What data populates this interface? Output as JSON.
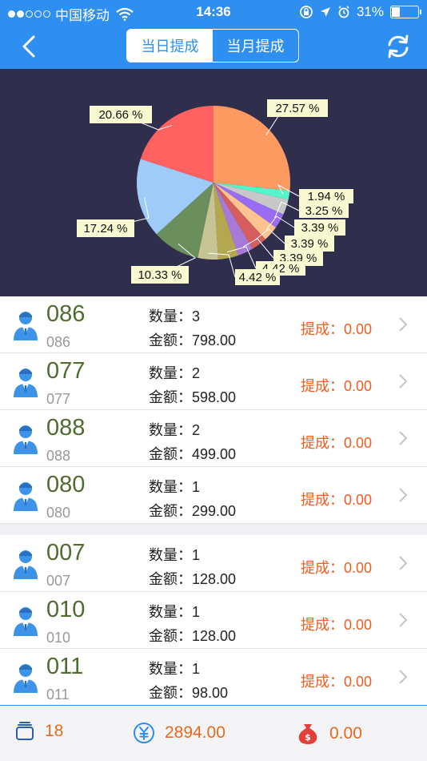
{
  "status": {
    "carrier": "中国移动",
    "time": "14:36",
    "battery": "31%",
    "battery_level": 0.31
  },
  "nav": {
    "back_icon": "chevron-left-icon",
    "tabs": [
      "当日提成",
      "当月提成"
    ],
    "active_tab": 0,
    "refresh_icon": "refresh-icon"
  },
  "chart_data": {
    "type": "pie",
    "slices": [
      {
        "label": "27.57 %",
        "value": 27.57,
        "color": "#fd9a62"
      },
      {
        "label": "1.94 %",
        "value": 1.94,
        "color": "#56f5c9"
      },
      {
        "label": "",
        "value": 3.3,
        "color": "#c8c8c8"
      },
      {
        "label": "3.25 %",
        "value": 3.25,
        "color": "#9a6cf5"
      },
      {
        "label": "3.39 %",
        "value": 3.39,
        "color": "#fdc490"
      },
      {
        "label": "3.39 %",
        "value": 3.39,
        "color": "#d65d5d"
      },
      {
        "label": "3.39 %",
        "value": 3.39,
        "color": "#a77ad8"
      },
      {
        "label": "4.42 %",
        "value": 4.42,
        "color": "#b3a84f"
      },
      {
        "label": "4.42 %",
        "value": 4.42,
        "color": "#c7c494"
      },
      {
        "label": "10.33 %",
        "value": 10.33,
        "color": "#6a8f5c"
      },
      {
        "label": "17.24 %",
        "value": 17.24,
        "color": "#9ecbf8"
      },
      {
        "label": "20.66 %",
        "value": 20.66,
        "color": "#ff6161"
      }
    ],
    "label_display": [
      "27.57 %",
      "1.94 %",
      "3.25 %",
      "3.39 %",
      "3.39 %",
      "3.39 %",
      "4.42 %",
      "4.42 %",
      "10.33 %",
      "17.24 %",
      "20.66 %"
    ]
  },
  "list_labels": {
    "qty": "数量：",
    "amount": "金额：",
    "commission": "提成："
  },
  "rows": [
    {
      "code": "086",
      "sub": "086",
      "qty": "3",
      "amount": "798.00",
      "commission": "0.00"
    },
    {
      "code": "077",
      "sub": "077",
      "qty": "2",
      "amount": "598.00",
      "commission": "0.00"
    },
    {
      "code": "088",
      "sub": "088",
      "qty": "2",
      "amount": "499.00",
      "commission": "0.00"
    },
    {
      "code": "080",
      "sub": "080",
      "qty": "1",
      "amount": "299.00",
      "commission": "0.00"
    },
    {
      "code": "007",
      "sub": "007",
      "qty": "1",
      "amount": "128.00",
      "commission": "0.00"
    },
    {
      "code": "010",
      "sub": "010",
      "qty": "1",
      "amount": "128.00",
      "commission": "0.00"
    },
    {
      "code": "011",
      "sub": "011",
      "qty": "1",
      "amount": "98.00",
      "commission": "0.00"
    }
  ],
  "footer": {
    "count": "18",
    "total": "2894.00",
    "commission_total": "0.00",
    "count_icon": "stack-icon",
    "total_icon": "yen-icon",
    "commission_icon": "money-bag-icon"
  }
}
